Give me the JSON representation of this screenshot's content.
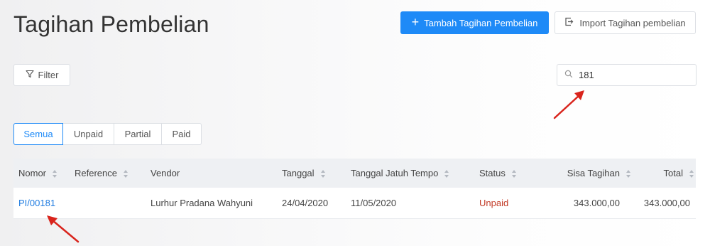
{
  "page": {
    "title": "Tagihan Pembelian"
  },
  "header": {
    "add_button_label": "Tambah Tagihan Pembelian",
    "import_button_label": "Import Tagihan pembelian"
  },
  "toolbar": {
    "filter_label": "Filter",
    "search_value": "181"
  },
  "tabs": [
    {
      "label": "Semua",
      "active": true
    },
    {
      "label": "Unpaid",
      "active": false
    },
    {
      "label": "Partial",
      "active": false
    },
    {
      "label": "Paid",
      "active": false
    }
  ],
  "table": {
    "columns": [
      "Nomor",
      "Reference",
      "Vendor",
      "Tanggal",
      "Tanggal Jatuh Tempo",
      "Status",
      "Sisa Tagihan",
      "Total"
    ],
    "rows": [
      {
        "nomor": "PI/00181",
        "reference": "",
        "vendor": "Lurhur Pradana Wahyuni",
        "tanggal": "24/04/2020",
        "jatuh_tempo": "11/05/2020",
        "status": "Unpaid",
        "sisa_tagihan": "343.000,00",
        "total": "343.000,00"
      }
    ]
  },
  "icons": {
    "add": "plus-icon",
    "import": "import-icon",
    "filter": "filter-icon",
    "search": "search-icon",
    "sort": "sort-icon",
    "annotation": "red-arrow"
  },
  "colors": {
    "primary": "#1e8af7",
    "link": "#1e7be0",
    "status_unpaid": "#c23a26",
    "annotation_arrow": "#d9241c"
  }
}
